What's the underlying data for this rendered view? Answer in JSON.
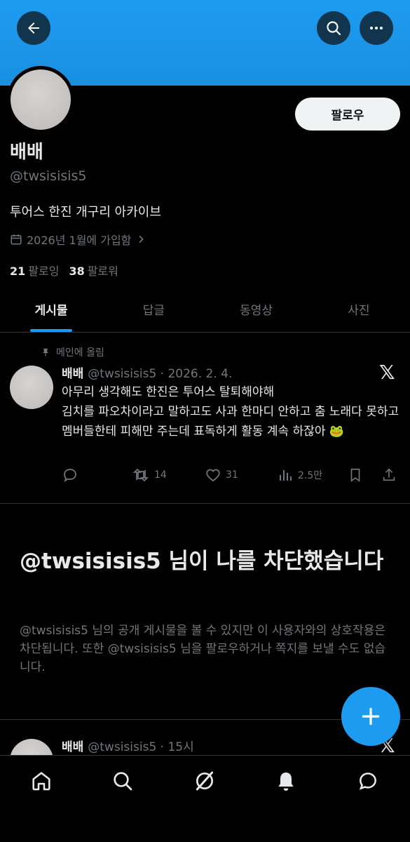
{
  "profile": {
    "display_name": "배배",
    "handle": "@twsisisis5",
    "bio": "투어스 한진 개구리 아카이브",
    "joined": "2026년 1월에 가입함",
    "following_count": "21",
    "following_label": "팔로잉",
    "followers_count": "38",
    "followers_label": "팔로워",
    "follow_button": "팔로우"
  },
  "header": {
    "back_icon": "arrow-left-icon",
    "search_icon": "search-icon",
    "more_icon": "more-horizontal-icon"
  },
  "tabs": [
    {
      "label": "게시물",
      "active": true
    },
    {
      "label": "답글",
      "active": false
    },
    {
      "label": "동영상",
      "active": false
    },
    {
      "label": "사진",
      "active": false
    }
  ],
  "pinned_post": {
    "pinned_label": "메인에 올림",
    "name": "배배",
    "meta": "@twsisisis5 · 2026. 2. 4.",
    "text": "아무리 생각해도 한진은 투어스 탈퇴해야해\n김치를 파오차이라고 말하고도 사과 한마디 안하고 춤 노래다 못하고 멤버들한테 피해만 주는데 표독하게 활동 계속 하잖아 🐸",
    "reply_count": "",
    "retweet_count": "14",
    "like_count": "31",
    "views_count": "2.5만"
  },
  "blocked": {
    "title": "@twsisisis5 님이 나를 차단했습니다",
    "description": "@twsisisis5 님의 공개 게시물을 볼 수 있지만 이 사용자와의 상호작용은 차단됩니다. 또한 @twsisisis5 님을 팔로우하거나 쪽지를 보낼 수도 없습니다."
  },
  "second_post": {
    "name": "배배",
    "meta": "@twsisisis5 · 15시"
  },
  "colors": {
    "accent": "#1d9bf0",
    "text_primary": "#e7e9ea",
    "text_secondary": "#71767b",
    "background": "#000000",
    "border": "#2f3336"
  },
  "nav": [
    "home-icon",
    "search-icon",
    "grok-icon",
    "notifications-icon",
    "messages-icon"
  ]
}
